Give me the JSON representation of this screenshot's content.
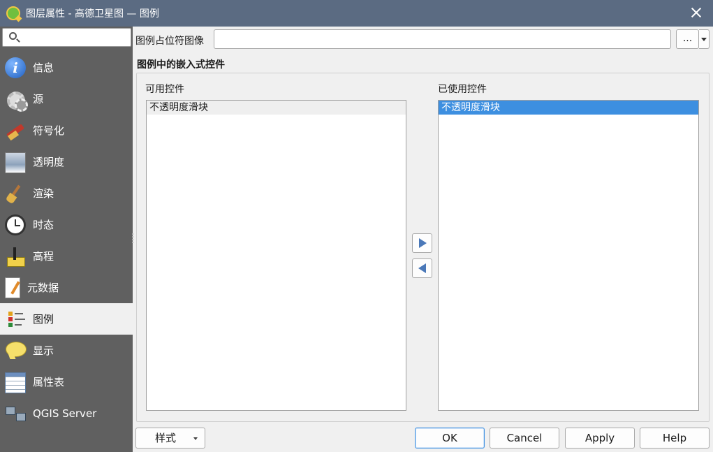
{
  "window": {
    "title": "图层属性 - 高德卫星图 — 图例",
    "icon": "qgis-logo-icon",
    "close_icon": "close-icon"
  },
  "sidebar": {
    "search": {
      "value": "",
      "placeholder": "",
      "icon": "search-icon"
    },
    "items": [
      {
        "label": "信息",
        "icon": "info-icon"
      },
      {
        "label": "源",
        "icon": "source-icon"
      },
      {
        "label": "符号化",
        "icon": "symbology-icon"
      },
      {
        "label": "透明度",
        "icon": "transparency-icon"
      },
      {
        "label": "渲染",
        "icon": "rendering-icon"
      },
      {
        "label": "时态",
        "icon": "clock-icon"
      },
      {
        "label": "高程",
        "icon": "elevation-icon"
      },
      {
        "label": "元数据",
        "icon": "metadata-icon"
      },
      {
        "label": "图例",
        "icon": "legend-icon",
        "selected": true
      },
      {
        "label": "显示",
        "icon": "display-icon"
      },
      {
        "label": "属性表",
        "icon": "attribute-table-icon"
      },
      {
        "label": "QGIS Server",
        "icon": "server-icon"
      }
    ]
  },
  "legend_page": {
    "placeholder_label": "图例占位符图像",
    "placeholder_value": "",
    "browse_label": "...",
    "group_title": "图例中的嵌入式控件",
    "available": {
      "label": "可用控件",
      "items": [
        "不透明度滑块"
      ]
    },
    "used": {
      "label": "已使用控件",
      "items": [
        "不透明度滑块"
      ]
    }
  },
  "buttons": {
    "style": "样式",
    "ok": "OK",
    "cancel": "Cancel",
    "apply": "Apply",
    "help": "Help"
  },
  "colors": {
    "titlebar": "#5b6b82",
    "sidebar": "#606060",
    "selection": "#3d8fe0",
    "arrow": "#4a78b8"
  }
}
